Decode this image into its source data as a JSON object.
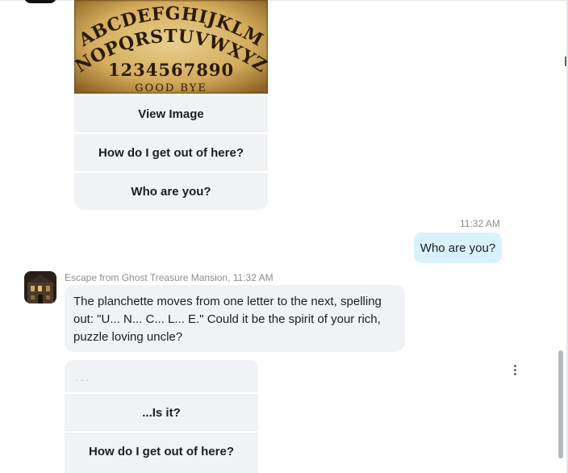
{
  "board_image": {
    "alphabet_row_1": "ABCDEFGHIJKLM",
    "alphabet_row_2": "NOPQRSTUVWXYZ",
    "numbers": "1234567890",
    "footer": "GOOD BYE"
  },
  "bot_card": {
    "buttons": [
      "View Image",
      "How do I get out of here?",
      "Who are you?"
    ]
  },
  "user_message": {
    "timestamp": "11:32 AM",
    "text": "Who are you?"
  },
  "bot_message": {
    "sender": "Escape from Ghost Treasure Mansion, 11:32 AM",
    "text": "The planchette moves from one letter to the next, spelling out: \"U... N... C... L... E.\" Could it be the spirit of your rich, puzzle loving uncle?"
  },
  "reply_card": {
    "typing": "...",
    "buttons": [
      "...Is it?",
      "How do I get out of here?"
    ]
  },
  "icons": {
    "more": "more-vertical-icon"
  },
  "colors": {
    "user_bubble": "#d8f2fb",
    "bot_bubble": "#f0f2f5",
    "timestamp": "#8a8d91"
  }
}
